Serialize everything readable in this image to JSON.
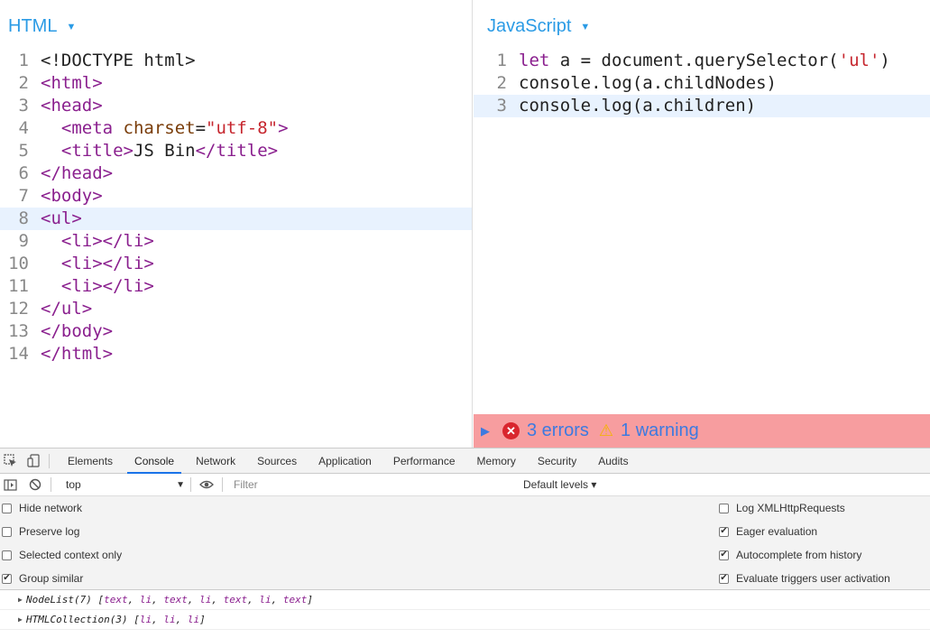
{
  "html_pane": {
    "title": "HTML",
    "caret": "▼",
    "lines": [
      {
        "n": "1",
        "segments": [
          {
            "cls": "plain",
            "t": "<!DOCTYPE html>"
          }
        ]
      },
      {
        "n": "2",
        "segments": [
          {
            "cls": "tag",
            "t": "<html>"
          }
        ]
      },
      {
        "n": "3",
        "segments": [
          {
            "cls": "tag",
            "t": "<head>"
          }
        ]
      },
      {
        "n": "4",
        "segments": [
          {
            "cls": "tag",
            "t": "  <meta "
          },
          {
            "cls": "attr",
            "t": "charset"
          },
          {
            "cls": "plain",
            "t": "="
          },
          {
            "cls": "str",
            "t": "\"utf-8\""
          },
          {
            "cls": "tag",
            "t": ">"
          }
        ]
      },
      {
        "n": "5",
        "segments": [
          {
            "cls": "tag",
            "t": "  <title>"
          },
          {
            "cls": "txt",
            "t": "JS Bin"
          },
          {
            "cls": "tag",
            "t": "</title>"
          }
        ]
      },
      {
        "n": "6",
        "segments": [
          {
            "cls": "tag",
            "t": "</head>"
          }
        ]
      },
      {
        "n": "7",
        "segments": [
          {
            "cls": "tag",
            "t": "<body>"
          }
        ]
      },
      {
        "n": "8",
        "segments": [
          {
            "cls": "tag",
            "t": "<ul>"
          }
        ],
        "active": true
      },
      {
        "n": "9",
        "segments": [
          {
            "cls": "tag",
            "t": "  <li></li>"
          }
        ]
      },
      {
        "n": "10",
        "segments": [
          {
            "cls": "tag",
            "t": "  <li></li>"
          }
        ]
      },
      {
        "n": "11",
        "segments": [
          {
            "cls": "tag",
            "t": "  <li></li>"
          }
        ]
      },
      {
        "n": "12",
        "segments": [
          {
            "cls": "tag",
            "t": "</ul>"
          }
        ]
      },
      {
        "n": "13",
        "segments": [
          {
            "cls": "tag",
            "t": "</body>"
          }
        ]
      },
      {
        "n": "14",
        "segments": [
          {
            "cls": "tag",
            "t": "</html>"
          }
        ]
      }
    ]
  },
  "js_pane": {
    "title": "JavaScript",
    "caret": "▼",
    "lines": [
      {
        "n": "1",
        "segments": [
          {
            "cls": "kw",
            "t": "let"
          },
          {
            "cls": "plain",
            "t": " a = document.querySelector("
          },
          {
            "cls": "str",
            "t": "'ul'"
          },
          {
            "cls": "plain",
            "t": ")"
          }
        ]
      },
      {
        "n": "2",
        "segments": [
          {
            "cls": "plain",
            "t": "console.log(a.childNodes)"
          }
        ]
      },
      {
        "n": "3",
        "segments": [
          {
            "cls": "plain",
            "t": "console.log(a.children)"
          }
        ],
        "active": true
      }
    ]
  },
  "error_bar": {
    "expand_glyph": "▶",
    "error_glyph": "✕",
    "errors_text": "3 errors",
    "warning_glyph": "⚠",
    "warnings_text": "1 warning"
  },
  "devtools": {
    "tabs": [
      "Elements",
      "Console",
      "Network",
      "Sources",
      "Application",
      "Performance",
      "Memory",
      "Security",
      "Audits"
    ],
    "selected_tab": "Console",
    "context": "top",
    "context_caret": "▼",
    "filter_placeholder": "Filter",
    "levels_label": "Default levels ▾",
    "settings_left": [
      {
        "label": "Hide network",
        "checked": false
      },
      {
        "label": "Preserve log",
        "checked": false
      },
      {
        "label": "Selected context only",
        "checked": false
      },
      {
        "label": "Group similar",
        "checked": true
      }
    ],
    "settings_right": [
      {
        "label": "Log XMLHttpRequests",
        "checked": false
      },
      {
        "label": "Eager evaluation",
        "checked": true
      },
      {
        "label": "Autocomplete from history",
        "checked": true
      },
      {
        "label": "Evaluate triggers user activation",
        "checked": true
      }
    ],
    "logs": [
      {
        "prefix": "NodeList(7) [",
        "items": [
          "text",
          "li",
          "text",
          "li",
          "text",
          "li",
          "text"
        ],
        "suffix": "]"
      },
      {
        "prefix": "HTMLCollection(3) [",
        "items": [
          "li",
          "li",
          "li"
        ],
        "suffix": "]"
      }
    ],
    "icons": {
      "inspect": "inspect-element-icon",
      "device": "device-toolbar-icon",
      "sidebar": "sidebar-toggle-icon",
      "clear": "clear-console-icon",
      "eye": "live-expression-icon"
    }
  }
}
